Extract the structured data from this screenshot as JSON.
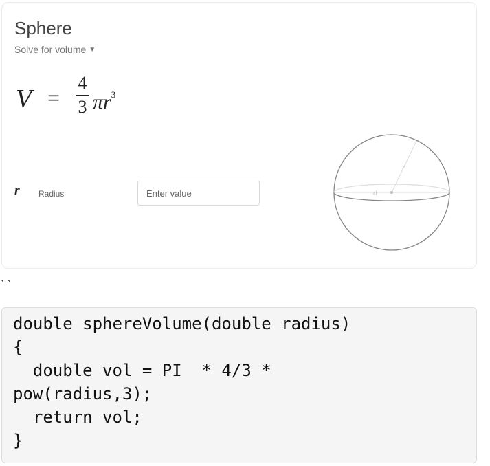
{
  "calculator": {
    "title": "Sphere",
    "solve_prefix": "Solve for ",
    "solve_target": "volume",
    "formula": {
      "lhs": "V",
      "equals": "=",
      "numerator": "4",
      "denominator": "3",
      "pi_r": "πr",
      "exponent": "3"
    },
    "variable": {
      "symbol": "r",
      "label": "Radius",
      "placeholder": "Enter value",
      "value": ""
    },
    "diagram": {
      "radius_label": "r",
      "diameter_label": "d"
    }
  },
  "markdown_ticks": "``",
  "code": {
    "lines": [
      "double sphereVolume(double radius)",
      "{",
      "  double vol = PI  * 4/3 *",
      "pow(radius,3);",
      "  return vol;",
      "}"
    ]
  }
}
